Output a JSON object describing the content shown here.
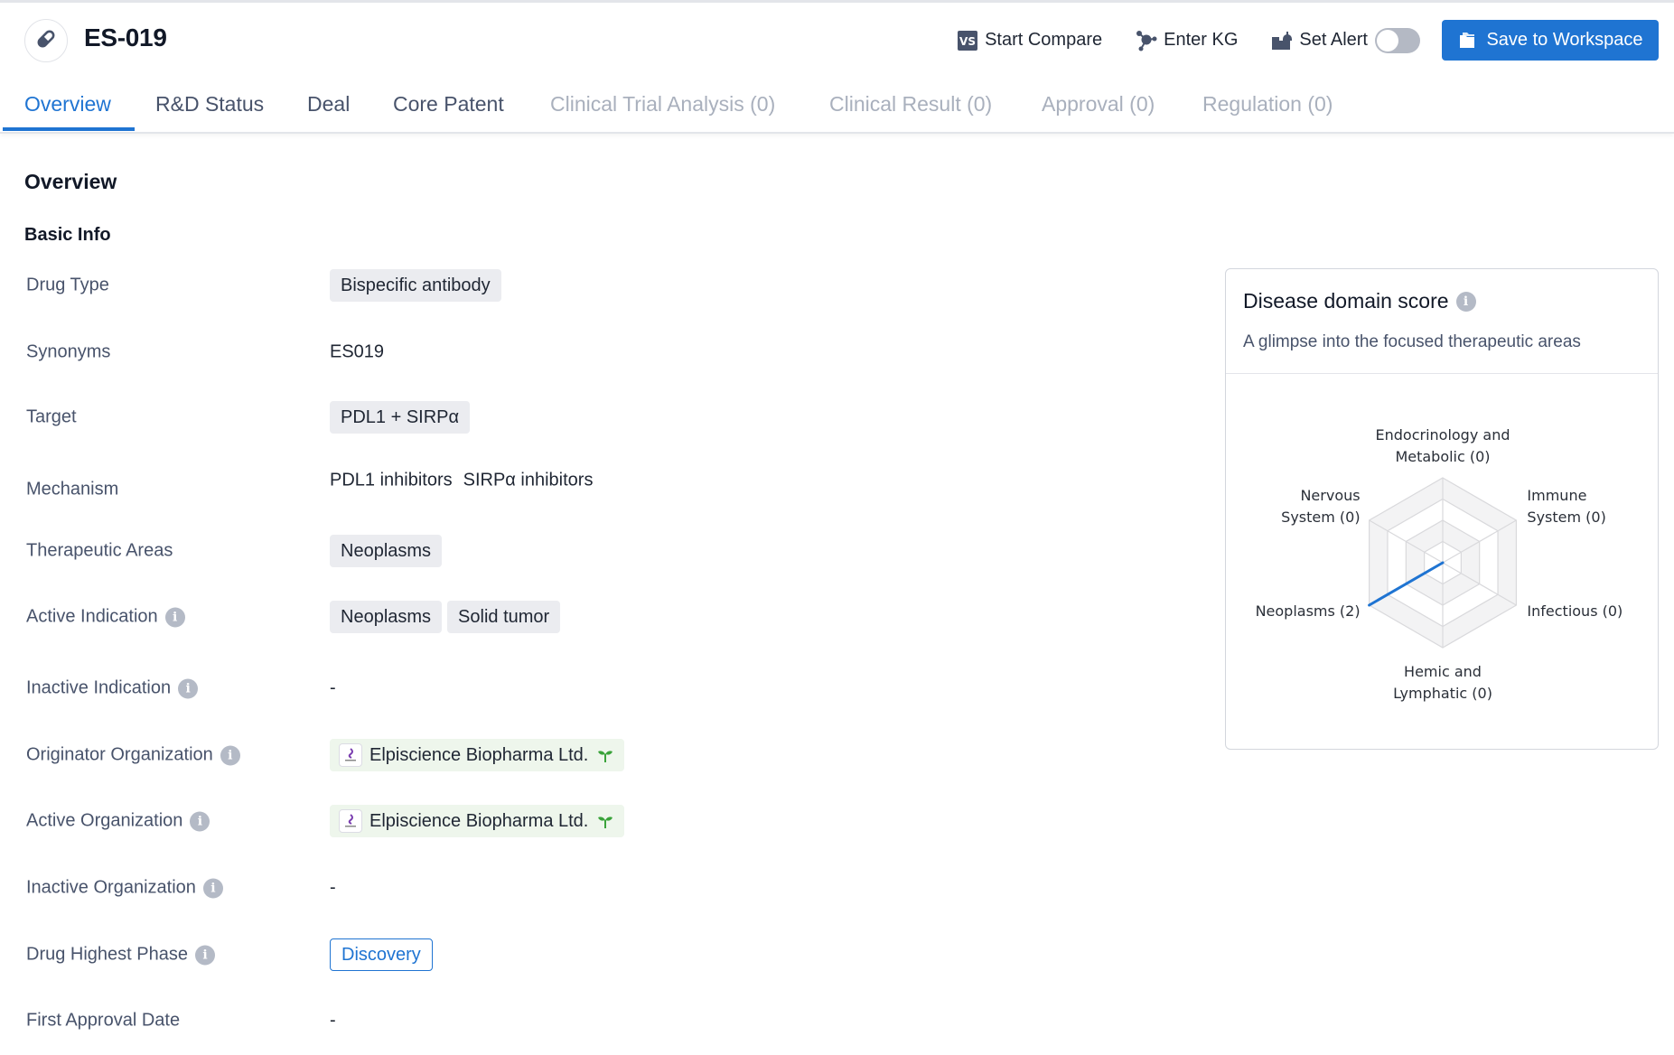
{
  "header": {
    "drug_icon": "pill-icon",
    "title": "ES-019",
    "actions": {
      "compare": {
        "icon": "vs-icon",
        "label": "Start Compare"
      },
      "kg": {
        "icon": "knowledge-graph-icon",
        "label": "Enter KG"
      },
      "alert": {
        "icon": "alert-bell-icon",
        "label": "Set Alert",
        "toggle_on": false
      },
      "save": {
        "icon": "folder-icon",
        "label": "Save to Workspace"
      }
    }
  },
  "tabs": [
    {
      "label": "Overview",
      "state": "active"
    },
    {
      "label": "R&D Status",
      "state": "normal"
    },
    {
      "label": "Deal",
      "state": "normal"
    },
    {
      "label": "Core Patent",
      "state": "normal"
    },
    {
      "label": "Clinical Trial Analysis (0)",
      "state": "disabled"
    },
    {
      "label": "Clinical Result (0)",
      "state": "disabled"
    },
    {
      "label": "Approval (0)",
      "state": "disabled"
    },
    {
      "label": "Regulation (0)",
      "state": "disabled"
    }
  ],
  "overview": {
    "title": "Overview",
    "basic_info_title": "Basic Info",
    "rows": {
      "drug_type": {
        "label": "Drug Type",
        "tags": [
          "Bispecific antibody"
        ]
      },
      "synonyms": {
        "label": "Synonyms",
        "value": "ES019"
      },
      "target": {
        "label": "Target",
        "tags": [
          "PDL1 + SIRPα"
        ]
      },
      "mechanism": {
        "label": "Mechanism",
        "items": [
          "PDL1 inhibitors",
          "SIRPα inhibitors"
        ]
      },
      "therapeutic_areas": {
        "label": "Therapeutic Areas",
        "tags": [
          "Neoplasms"
        ]
      },
      "active_indication": {
        "label": "Active Indication",
        "tags": [
          "Neoplasms",
          "Solid tumor"
        ]
      },
      "inactive_indication": {
        "label": "Inactive Indication",
        "value": "-"
      },
      "originator_org": {
        "label": "Originator Organization",
        "org": "Elpiscience Biopharma Ltd."
      },
      "active_org": {
        "label": "Active Organization",
        "org": "Elpiscience Biopharma Ltd."
      },
      "inactive_org": {
        "label": "Inactive Organization",
        "value": "-"
      },
      "highest_phase": {
        "label": "Drug Highest Phase",
        "value": "Discovery"
      },
      "first_approval": {
        "label": "First Approval Date",
        "value": "-"
      }
    }
  },
  "disease_card": {
    "title": "Disease domain score",
    "subtitle": "A glimpse into the focused therapeutic areas"
  },
  "chart_data": {
    "type": "radar",
    "title": "Disease domain score",
    "axes": [
      {
        "name": "Endocrinology and Metabolic",
        "label_lines": [
          "Endocrinology and",
          "Metabolic (0)"
        ],
        "value": 0
      },
      {
        "name": "Immune System",
        "label_lines": [
          "Immune",
          "System (0)"
        ],
        "value": 0
      },
      {
        "name": "Infectious",
        "label_lines": [
          "Infectious (0)"
        ],
        "value": 0
      },
      {
        "name": "Hemic and Lymphatic",
        "label_lines": [
          "Hemic and",
          "Lymphatic (0)"
        ],
        "value": 0
      },
      {
        "name": "Neoplasms",
        "label_lines": [
          "Neoplasms (2)"
        ],
        "value": 2
      },
      {
        "name": "Nervous System",
        "label_lines": [
          "Nervous",
          "System (0)"
        ],
        "value": 0
      }
    ],
    "max": 2,
    "rings": 4,
    "series_color": "#1f74d2"
  },
  "colors": {
    "accent": "#1f74d2",
    "tag_bg": "#ebecf0",
    "org_tag_bg": "#eef6ec",
    "label": "#48536b",
    "disabled_tab": "#a9b0bd"
  }
}
